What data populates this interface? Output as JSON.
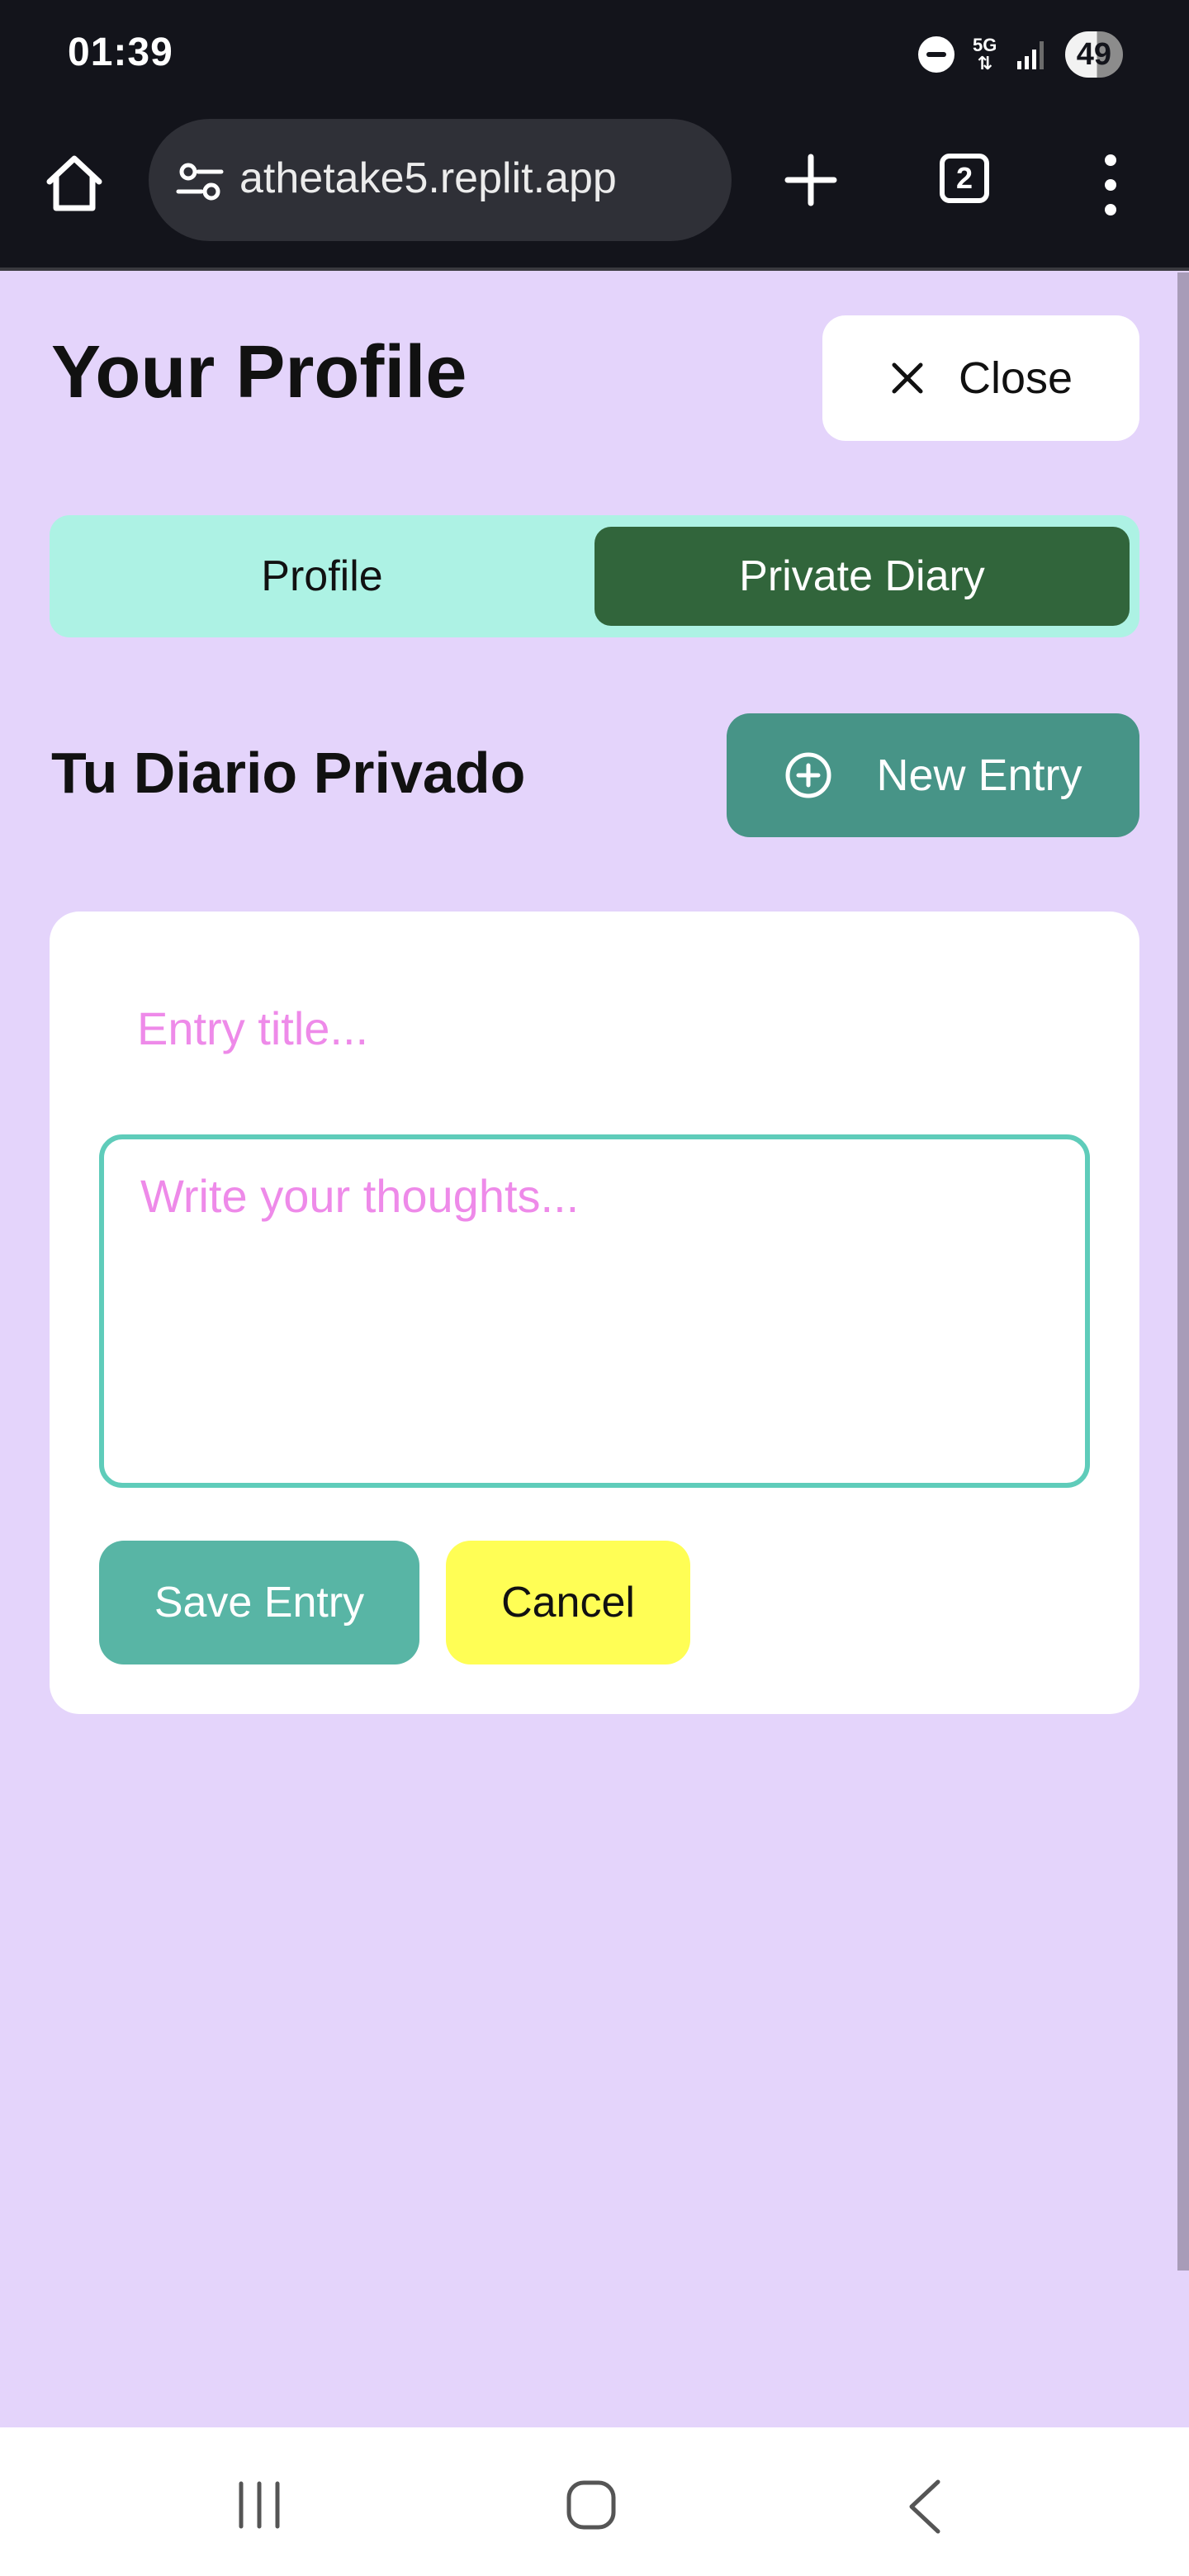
{
  "status_bar": {
    "time": "01:39",
    "network": "5G",
    "battery": "49"
  },
  "browser": {
    "url": "athetake5.replit.app",
    "tab_count": "2",
    "icons": [
      "home-icon",
      "site-settings-icon",
      "plus-icon",
      "tabs-icon",
      "more-vert-icon"
    ]
  },
  "header": {
    "title": "Your Profile",
    "close_label": "Close"
  },
  "tabs": [
    {
      "label": "Profile",
      "active": false
    },
    {
      "label": "Private Diary",
      "active": true
    }
  ],
  "diary": {
    "heading": "Tu Diario Privado",
    "new_entry_label": "New Entry",
    "title_placeholder": "Entry title...",
    "body_placeholder": "Write your thoughts...",
    "save_label": "Save Entry",
    "cancel_label": "Cancel"
  },
  "colors": {
    "page_bg": "#E4D4FB",
    "tab_bg": "#ADF2E4",
    "tab_active": "#31653B",
    "new_entry_bg": "#479487",
    "save_bg": "#58B5A5",
    "cancel_bg": "#FFFE55",
    "placeholder": "#EE8AE9",
    "textarea_border": "#5FCCBA"
  }
}
